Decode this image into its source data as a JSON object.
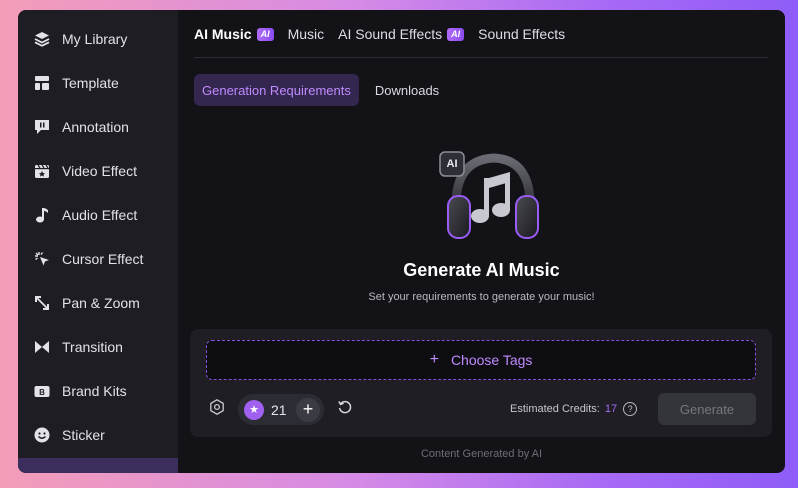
{
  "sidebar": {
    "items": [
      {
        "label": "My Library",
        "icon": "layers-icon"
      },
      {
        "label": "Template",
        "icon": "template-icon"
      },
      {
        "label": "Annotation",
        "icon": "annotation-icon"
      },
      {
        "label": "Video Effect",
        "icon": "video-effect-icon"
      },
      {
        "label": "Audio Effect",
        "icon": "music-note-icon"
      },
      {
        "label": "Cursor Effect",
        "icon": "cursor-click-icon"
      },
      {
        "label": "Pan & Zoom",
        "icon": "expand-arrows-icon"
      },
      {
        "label": "Transition",
        "icon": "transition-icon"
      },
      {
        "label": "Brand Kits",
        "icon": "brand-kit-icon"
      },
      {
        "label": "Sticker",
        "icon": "smiley-icon"
      }
    ]
  },
  "tabs": {
    "top": [
      {
        "label": "AI Music",
        "badge": "AI",
        "active": true
      },
      {
        "label": "Music",
        "badge": "",
        "active": false
      },
      {
        "label": "AI Sound Effects",
        "badge": "AI",
        "active": false
      },
      {
        "label": "Sound Effects",
        "badge": "",
        "active": false
      }
    ],
    "sub": [
      {
        "label": "Generation Requirements",
        "active": true
      },
      {
        "label": "Downloads",
        "active": false
      }
    ]
  },
  "hero": {
    "badge": "AI",
    "title": "Generate AI Music",
    "subtitle": "Set your requirements to generate your music!"
  },
  "panel": {
    "choose_tags": "Choose Tags",
    "quantity": "21",
    "credits_label": "Estimated Credits:",
    "credits_value": "17",
    "help": "?",
    "generate": "Generate"
  },
  "footer": "Content Generated by AI",
  "colors": {
    "accent": "#a061f0",
    "background": "#121217",
    "sidebar": "#1d1d23"
  }
}
